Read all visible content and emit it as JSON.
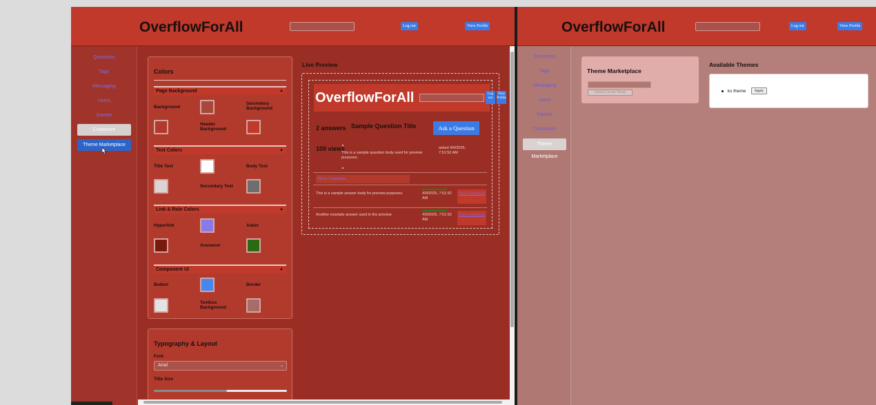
{
  "app": {
    "brand": "OverflowForAll"
  },
  "header": {
    "logout": "Log out",
    "view_profile": "View Profile"
  },
  "nav": [
    "Questions",
    "Tags",
    "Messaging",
    "Users",
    "Games",
    "Customize",
    "Theme Marketplace"
  ],
  "editor": {
    "colors_title": "Colors",
    "sections": {
      "page_background": "Page Background",
      "text_colors": "Text Colors",
      "link_role_colors": "Link & Role Colors",
      "component_ui": "Component UI"
    },
    "labels": {
      "background": "Background",
      "secondary_background": "Secondary Background",
      "header_background": "Header Background",
      "title_text": "Title Text",
      "body_text": "Body Text",
      "secondary_text": "Secondary Text",
      "hyperlink": "Hyperlink",
      "asker": "Asker",
      "answerer": "Answerer",
      "button": "Button",
      "border": "Border",
      "textbox_background": "Textbox Background"
    },
    "swatches": {
      "background": "#a8483c",
      "secondary_background": "#b13a2d",
      "header_background": "#c0392b",
      "title_text": "#ffffff",
      "body_text": "#dbd4d4",
      "secondary_text": "#6e6e6e",
      "hyperlink": "#8a7ae8",
      "asker": "#7a1a0f",
      "answerer": "#2a6a12",
      "button": "#4785ef",
      "border": "#e3e3e3",
      "textbox_background": "#a86b65"
    },
    "typography_title": "Typography & Layout",
    "font_label": "Font",
    "font_value": "Arial",
    "title_size_label": "Title Size",
    "title_size_fraction": 0.55
  },
  "preview": {
    "title": "Live Preview",
    "brand": "OverflowForAll",
    "logout": "Log out",
    "view_profile": "View Profile",
    "answers": "2 answers",
    "question_title": "Sample Question Title",
    "ask_button": "Ask a Question",
    "views": "100 views",
    "question_body": "This is a sample question body used for preview purposes.",
    "asked": "asked 4/9/2025, 7:51:52 AM",
    "show_comments": "Show Comments",
    "answers_list": [
      {
        "body": "This is a sample answer body for preview purposes.",
        "date": "4/9/2025, 7:51:52 AM"
      },
      {
        "body": "Another example answer used in the preview",
        "date": "4/9/2025, 7:51:52 AM"
      }
    ]
  },
  "marketplace": {
    "title": "Theme Marketplace",
    "upload_button": "Upload Current Theme",
    "available_title": "Available Themes",
    "themes": [
      {
        "name": "ks theme",
        "action": "Apply"
      }
    ]
  },
  "right_nav": [
    "Questions",
    "Tags",
    "Messaging",
    "Users",
    "Games",
    "Customize",
    "Theme",
    "Marketplace"
  ]
}
